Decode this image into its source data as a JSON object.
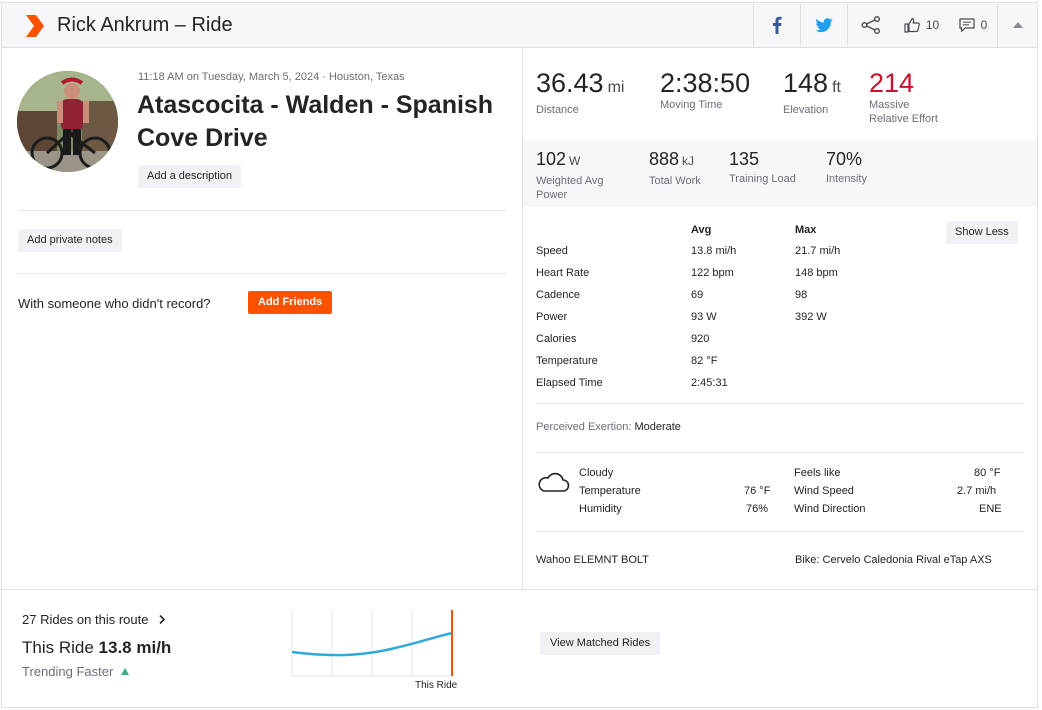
{
  "header": {
    "title": "Rick Ankrum – Ride",
    "kudos_count": "10",
    "comments_count": "0"
  },
  "activity": {
    "meta": "11:18 AM on Tuesday, March 5, 2024 · Houston, Texas",
    "title": "Atascocita - Walden - Spanish Cove Drive",
    "add_description": "Add a description",
    "add_private_notes": "Add private notes",
    "with_someone": "With someone who didn't record?",
    "add_friends": "Add Friends"
  },
  "primary_stats": [
    {
      "value": "36.43",
      "unit": "mi",
      "label": "Distance",
      "label2": ""
    },
    {
      "value": "2:38:50",
      "unit": "",
      "label": "Moving Time",
      "label2": ""
    },
    {
      "value": "148",
      "unit": "ft",
      "label": "Elevation",
      "label2": ""
    },
    {
      "value": "214",
      "unit": "",
      "label": "Massive",
      "label2": "Relative Effort"
    }
  ],
  "secondary_stats": [
    {
      "value": "102",
      "unit": "W",
      "label": "Weighted Avg",
      "label2": "Power"
    },
    {
      "value": "888",
      "unit": "kJ",
      "label": "Total Work",
      "label2": ""
    },
    {
      "value": "135",
      "unit": "",
      "label": "Training Load",
      "label2": ""
    },
    {
      "value": "70%",
      "unit": "",
      "label": "Intensity",
      "label2": ""
    }
  ],
  "more_stats": {
    "col_avg": "Avg",
    "col_max": "Max",
    "show_less": "Show Less",
    "rows": [
      {
        "label": "Speed",
        "avg": "13.8 mi/h",
        "max": "21.7 mi/h"
      },
      {
        "label": "Heart Rate",
        "avg": "122 bpm",
        "max": "148 bpm"
      },
      {
        "label": "Cadence",
        "avg": "69",
        "max": "98"
      },
      {
        "label": "Power",
        "avg": "93 W",
        "max": "392 W"
      },
      {
        "label": "Calories",
        "avg": "920",
        "max": ""
      },
      {
        "label": "Temperature",
        "avg": "82 °F",
        "max": ""
      },
      {
        "label": "Elapsed Time",
        "avg": "2:45:31",
        "max": ""
      }
    ]
  },
  "perceived_exertion": {
    "label": "Perceived Exertion:",
    "value": "Moderate"
  },
  "weather": {
    "condition": "Cloudy",
    "temperature_label": "Temperature",
    "temperature_value": "76 °F",
    "humidity_label": "Humidity",
    "humidity_value": "76%",
    "feels_like_label": "Feels like",
    "feels_like_value": "80 °F",
    "wind_speed_label": "Wind Speed",
    "wind_speed_value": "2.7 mi/h",
    "wind_direction_label": "Wind Direction",
    "wind_direction_value": "ENE"
  },
  "device": "Wahoo ELEMNT BOLT",
  "bike": "Bike: Cervelo Caledonia Rival eTap AXS",
  "route": {
    "rides_on_route": "27 Rides on this route",
    "this_ride_label": "This Ride",
    "this_ride_value": "13.8 mi/h",
    "trending": "Trending Faster",
    "chart_label": "This Ride",
    "view_matched": "View Matched Rides"
  },
  "colors": {
    "brand": "#fc5200",
    "relative_effort": "#c8102e",
    "trend_line": "#2fa8e0",
    "trend_up": "#3cb07e"
  }
}
